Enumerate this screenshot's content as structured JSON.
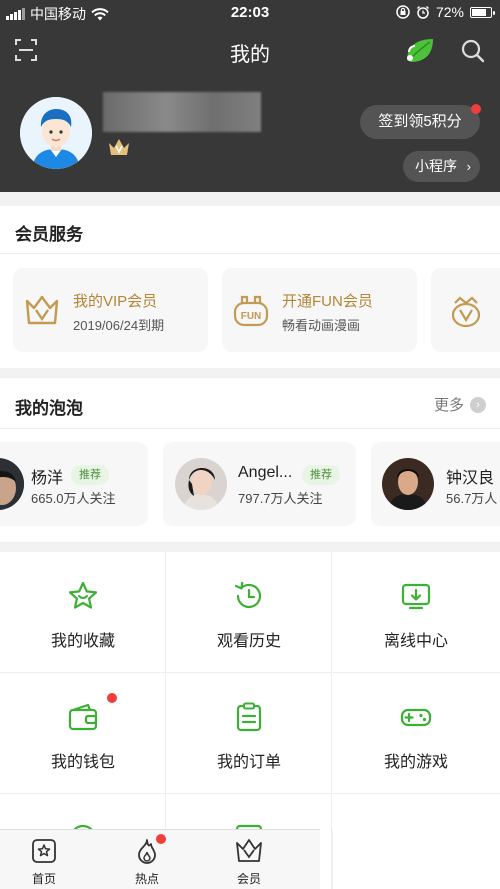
{
  "status_bar": {
    "carrier": "中国移动",
    "time": "22:03",
    "battery": "72%"
  },
  "nav": {
    "title": "我的"
  },
  "profile": {
    "checkin_label": "签到领5积分",
    "mini_program_label": "小程序",
    "mini_program_chevron": "›"
  },
  "vip_section": {
    "title": "会员服务",
    "cards": [
      {
        "title": "我的VIP会员",
        "subtitle": "2019/06/24到期",
        "icon": "crown-v-icon"
      },
      {
        "title": "开通FUN会员",
        "subtitle": "畅看动画漫画",
        "icon": "fun-icon"
      },
      {
        "title": "",
        "subtitle": "",
        "icon": "crown-v-icon"
      }
    ]
  },
  "bubble_section": {
    "title": "我的泡泡",
    "more_label": "更多",
    "more_chevron": "›",
    "items": [
      {
        "name": "杨洋",
        "tag": "推荐",
        "followers": "665.0万人关注"
      },
      {
        "name": "Angel...",
        "tag": "推荐",
        "followers": "797.7万人关注"
      },
      {
        "name": "钟汉良",
        "tag": "",
        "followers": "56.7万人"
      }
    ]
  },
  "grid": {
    "items": [
      {
        "label": "我的收藏",
        "icon": "star-icon"
      },
      {
        "label": "观看历史",
        "icon": "history-icon"
      },
      {
        "label": "离线中心",
        "icon": "download-icon"
      },
      {
        "label": "我的钱包",
        "icon": "wallet-icon"
      },
      {
        "label": "我的订单",
        "icon": "order-icon"
      },
      {
        "label": "我的游戏",
        "icon": "gamepad-icon"
      }
    ]
  },
  "tabbar": {
    "items": [
      {
        "label": "首页",
        "icon": "home-icon"
      },
      {
        "label": "热点",
        "icon": "flame-icon"
      },
      {
        "label": "会员",
        "icon": "vip-crown-icon"
      }
    ]
  },
  "colors": {
    "accent_green": "#3cb034",
    "gold": "#b38637",
    "header_bg": "#383838",
    "badge_red": "#f23d3d"
  }
}
